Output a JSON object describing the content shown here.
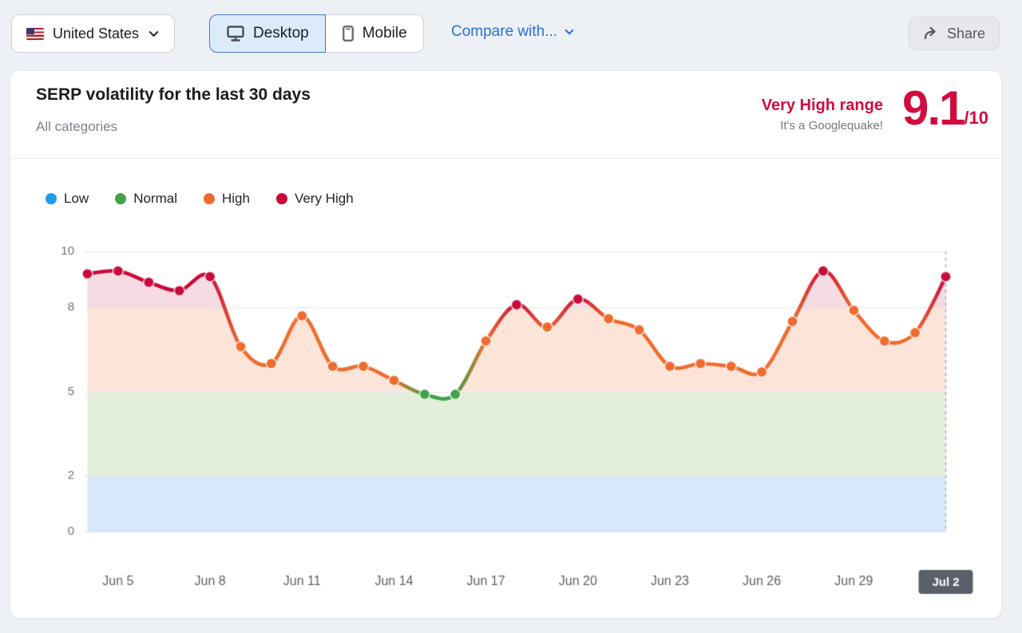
{
  "toolbar": {
    "country_selector": {
      "label": "United States",
      "flag": "us-flag"
    },
    "device_toggle": {
      "desktop": "Desktop",
      "mobile": "Mobile",
      "selected": "Desktop"
    },
    "compare": {
      "label": "Compare with..."
    },
    "share": {
      "label": "Share"
    }
  },
  "card": {
    "title": "SERP volatility for the last 30 days",
    "subtitle": "All categories",
    "score": {
      "range_label": "Very High range",
      "note": "It's a Googlequake!",
      "value": "9.1",
      "scale": "/10",
      "color": "#d20b3e"
    }
  },
  "chart_data": {
    "type": "area",
    "title": "SERP volatility for the last 30 days",
    "x": [
      "Jun 4",
      "Jun 5",
      "Jun 6",
      "Jun 7",
      "Jun 8",
      "Jun 9",
      "Jun 10",
      "Jun 11",
      "Jun 12",
      "Jun 13",
      "Jun 14",
      "Jun 15",
      "Jun 16",
      "Jun 17",
      "Jun 18",
      "Jun 19",
      "Jun 20",
      "Jun 21",
      "Jun 22",
      "Jun 23",
      "Jun 24",
      "Jun 25",
      "Jun 26",
      "Jun 27",
      "Jun 28",
      "Jun 29",
      "Jun 30",
      "Jul 1",
      "Jul 2"
    ],
    "values": [
      9.2,
      9.3,
      8.9,
      8.6,
      9.1,
      6.6,
      6.0,
      7.7,
      5.9,
      5.9,
      5.4,
      4.9,
      4.9,
      6.8,
      8.1,
      7.3,
      8.3,
      7.6,
      7.2,
      5.9,
      6.0,
      5.9,
      5.7,
      7.5,
      9.3,
      7.9,
      6.8,
      7.1,
      9.1
    ],
    "ylim": [
      0,
      10
    ],
    "yticks": [
      0,
      2,
      5,
      8,
      10
    ],
    "xticks": [
      "Jun 5",
      "Jun 8",
      "Jun 11",
      "Jun 14",
      "Jun 17",
      "Jun 20",
      "Jun 23",
      "Jun 26",
      "Jun 29",
      "Jul 2"
    ],
    "grid": true,
    "legend_position": "top-left",
    "legend": [
      {
        "label": "Low",
        "color": "#1e9bf0"
      },
      {
        "label": "Normal",
        "color": "#44a248"
      },
      {
        "label": "High",
        "color": "#ef6c2e"
      },
      {
        "label": "Very High",
        "color": "#c80b3c"
      }
    ],
    "thresholds": {
      "low_max": 2,
      "normal_max": 5,
      "high_max": 8
    },
    "bands": [
      {
        "from": 0,
        "to": 2,
        "color": "#d7e8fa"
      },
      {
        "from": 2,
        "to": 5,
        "color": "#e3efda"
      },
      {
        "from": 5,
        "to": 8,
        "color": "#fce5d8"
      },
      {
        "from": 8,
        "to": 10,
        "color": "#f6dbe2"
      }
    ],
    "last_tick_badge": {
      "label": "Jul 2",
      "bg": "#5a606a",
      "text_color": "#ffffff"
    },
    "axis_text_color": "#6d7178",
    "grid_color": "#e0e3e8",
    "dashed_line_color": "#a9afb8"
  }
}
